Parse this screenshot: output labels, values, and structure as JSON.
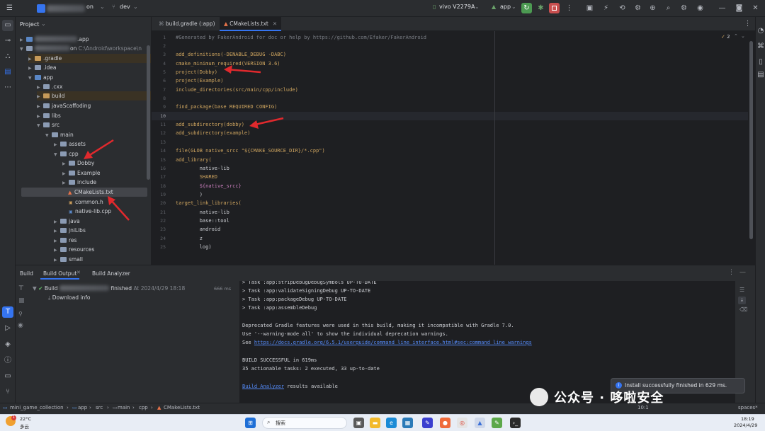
{
  "titlebar": {
    "project_name": "on",
    "branch": "dev",
    "device": "vivo V2279A",
    "run_config": "app"
  },
  "project_panel": {
    "title": "Project",
    "items": [
      {
        "label": ".app",
        "indent": 0,
        "kind": "module"
      },
      {
        "label": "on",
        "path": "C:\\Android\\workspace\\n",
        "indent": 0,
        "kind": "folder"
      },
      {
        "label": ".gradle",
        "indent": 1,
        "kind": "folder-orange"
      },
      {
        "label": ".idea",
        "indent": 1,
        "kind": "folder"
      },
      {
        "label": "app",
        "indent": 1,
        "kind": "folder-module"
      },
      {
        "label": ".cxx",
        "indent": 2,
        "kind": "folder"
      },
      {
        "label": "build",
        "indent": 2,
        "kind": "folder-orange"
      },
      {
        "label": "javaScaffoding",
        "indent": 2,
        "kind": "folder"
      },
      {
        "label": "libs",
        "indent": 2,
        "kind": "folder"
      },
      {
        "label": "src",
        "indent": 2,
        "kind": "folder"
      },
      {
        "label": "main",
        "indent": 3,
        "kind": "folder"
      },
      {
        "label": "assets",
        "indent": 4,
        "kind": "folder"
      },
      {
        "label": "cpp",
        "indent": 4,
        "kind": "folder"
      },
      {
        "label": "Dobby",
        "indent": 5,
        "kind": "folder"
      },
      {
        "label": "Example",
        "indent": 5,
        "kind": "folder"
      },
      {
        "label": "include",
        "indent": 5,
        "kind": "folder"
      },
      {
        "label": "CMakeLists.txt",
        "indent": 5,
        "kind": "cmake"
      },
      {
        "label": "common.h",
        "indent": 5,
        "kind": "header"
      },
      {
        "label": "native-lib.cpp",
        "indent": 5,
        "kind": "cpp"
      },
      {
        "label": "java",
        "indent": 4,
        "kind": "folder"
      },
      {
        "label": "jniLibs",
        "indent": 4,
        "kind": "folder"
      },
      {
        "label": "res",
        "indent": 4,
        "kind": "folder"
      },
      {
        "label": "resources",
        "indent": 4,
        "kind": "folder"
      },
      {
        "label": "small",
        "indent": 4,
        "kind": "folder"
      }
    ]
  },
  "editor_tabs": [
    {
      "label": "build.gradle (:app)",
      "active": false
    },
    {
      "label": "CMakeLists.txt",
      "active": true
    }
  ],
  "editor": {
    "warnings": "2",
    "lines": [
      {
        "n": "1",
        "text": "#Generated by FakerAndroid for doc or help by https://github.com/Efaker/FakerAndroid"
      },
      {
        "n": "2",
        "text": ""
      },
      {
        "n": "3",
        "text": "add_definitions(-DENABLE_DEBUG -DABC)"
      },
      {
        "n": "4",
        "text": "cmake_minimum_required(VERSION 3.6)"
      },
      {
        "n": "5",
        "text": "project(Dobby)"
      },
      {
        "n": "6",
        "text": "project(Example)"
      },
      {
        "n": "7",
        "text": "include_directories(src/main/cpp/include)"
      },
      {
        "n": "8",
        "text": ""
      },
      {
        "n": "9",
        "text": "find_package(base REQUIRED CONFIG)"
      },
      {
        "n": "10",
        "text": ""
      },
      {
        "n": "11",
        "text": "add_subdirectory(dobby)"
      },
      {
        "n": "12",
        "text": "add_subdirectory(example)"
      },
      {
        "n": "13",
        "text": ""
      },
      {
        "n": "14",
        "text": "file(GLOB native_srcc \"${CMAKE_SOURCE_DIR}/*.cpp\")"
      },
      {
        "n": "15",
        "text": "add_library("
      },
      {
        "n": "16",
        "text": "        native-lib"
      },
      {
        "n": "17",
        "text": "        SHARED"
      },
      {
        "n": "18",
        "text": "        ${native_srcc}"
      },
      {
        "n": "19",
        "text": "        )"
      },
      {
        "n": "20",
        "text": "target_link_libraries("
      },
      {
        "n": "21",
        "text": "        native-lib"
      },
      {
        "n": "22",
        "text": "        base::tool"
      },
      {
        "n": "23",
        "text": "        android"
      },
      {
        "n": "24",
        "text": "        z"
      },
      {
        "n": "25",
        "text": "        log)"
      }
    ]
  },
  "build_panel": {
    "tabs": [
      "Build",
      "Build Output",
      "Build Analyzer"
    ],
    "tree": {
      "root_label": "Build",
      "root_status": "finished",
      "root_time": "At 2024/4/29 18:18",
      "root_duration": "666 ms",
      "child": "Download info"
    },
    "output": [
      "> Task :app:stripDebugDebugSymbols UP-TO-DATE",
      "> Task :app:validateSigningDebug UP-TO-DATE",
      "> Task :app:packageDebug UP-TO-DATE",
      "> Task :app:assembleDebug",
      "",
      "Deprecated Gradle features were used in this build, making it incompatible with Gradle 7.0.",
      "Use '--warning-mode all' to show the individual deprecation warnings.",
      "See ",
      "",
      "BUILD SUCCESSFUL in 619ms",
      "35 actionable tasks: 2 executed, 33 up-to-date",
      "",
      " results available"
    ],
    "docs_link": "https://docs.gradle.org/6.5.1/userguide/command_line_interface.html#sec:command_line_warnings",
    "analyzer_link": "Build Analyzer"
  },
  "notification": "Install successfully finished in 629 ms.",
  "statusbar": {
    "breadcrumbs": [
      "mini_game_collection",
      "app",
      "src",
      "main",
      "cpp",
      "CMakeLists.txt"
    ],
    "position": "10:1",
    "encoding": "spaces*"
  },
  "taskbar": {
    "weather_temp": "22°C",
    "weather_desc": "多云",
    "search": "搜索",
    "time": "18:19",
    "date": "2024/4/29"
  },
  "watermark": "公众号 · 哆啦安全"
}
